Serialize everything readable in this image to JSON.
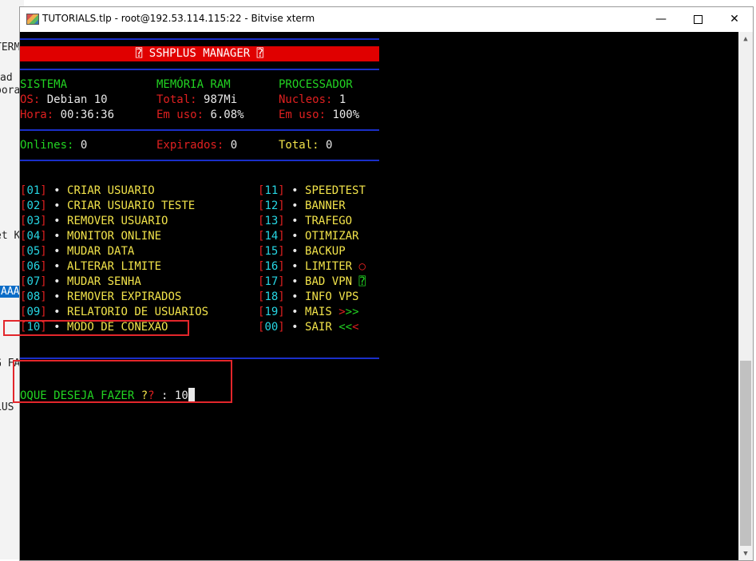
{
  "background": {
    "fragments": [
      {
        "text": "TERM"
      },
      {
        "text": "ad"
      },
      {
        "text": "pora"
      },
      {
        "text": "et K"
      },
      {
        "text": "AAAE"
      },
      {
        "text": "G FA"
      },
      {
        "text": "LUS"
      }
    ]
  },
  "window": {
    "title": "TUTORIALS.tlp - root@192.53.114.115:22 - Bitvise xterm",
    "minimize_glyph": "—",
    "close_glyph": "✕"
  },
  "terminal": {
    "banner": "⍰ SSHPLUS MANAGER ⍰",
    "stats": {
      "sistema_label": "SISTEMA",
      "memoria_label": "MEMÓRIA RAM",
      "processador_label": "PROCESSADOR",
      "os_label": "OS:",
      "os_value": "Debian 10",
      "total_label": "Total:",
      "total_value": "987Mi",
      "nucleos_label": "Nucleos:",
      "nucleos_value": "1",
      "hora_label": "Hora:",
      "hora_value": "00:36:36",
      "emuso_mem_label": "Em uso:",
      "emuso_mem_value": "6.08%",
      "emuso_cpu_label": "Em uso:",
      "emuso_cpu_value": "100%"
    },
    "counts": {
      "onlines_label": "Onlines:",
      "onlines_value": "0",
      "expirados_label": "Expirados:",
      "expirados_value": "0",
      "total_label": "Total:",
      "total_value": "0"
    },
    "menu_left": [
      {
        "num": "01",
        "label": "CRIAR USUARIO"
      },
      {
        "num": "02",
        "label": "CRIAR USUARIO TESTE"
      },
      {
        "num": "03",
        "label": "REMOVER USUARIO"
      },
      {
        "num": "04",
        "label": "MONITOR ONLINE"
      },
      {
        "num": "05",
        "label": "MUDAR DATA"
      },
      {
        "num": "06",
        "label": "ALTERAR LIMITE"
      },
      {
        "num": "07",
        "label": "MUDAR SENHA"
      },
      {
        "num": "08",
        "label": "REMOVER EXPIRADOS"
      },
      {
        "num": "09",
        "label": "RELATORIO DE USUARIOS"
      },
      {
        "num": "10",
        "label": "MODO DE CONEXAO"
      }
    ],
    "menu_right": [
      {
        "num": "11",
        "label": "SPEEDTEST",
        "suffix": ""
      },
      {
        "num": "12",
        "label": "BANNER",
        "suffix": ""
      },
      {
        "num": "13",
        "label": "TRAFEGO",
        "suffix": ""
      },
      {
        "num": "14",
        "label": "OTIMIZAR",
        "suffix": ""
      },
      {
        "num": "15",
        "label": "BACKUP",
        "suffix": ""
      },
      {
        "num": "16",
        "label": "LIMITER",
        "suffix": "○"
      },
      {
        "num": "17",
        "label": "BAD VPN",
        "suffix": "⍰"
      },
      {
        "num": "18",
        "label": "INFO VPS",
        "suffix": ""
      },
      {
        "num": "19",
        "label": "MAIS",
        "suffix": ">>>"
      },
      {
        "num": "00",
        "label": "SAIR",
        "suffix": "<<<"
      }
    ],
    "bullet": "•",
    "prompt": {
      "text": "OQUE DESEJA FAZER",
      "q1": "?",
      "q2": "?",
      "sep": " :",
      "input": "10"
    }
  },
  "colors": {
    "title_red": "#e00000",
    "rule_blue": "#1a2fc9",
    "highlight_box": "#e3262b"
  }
}
